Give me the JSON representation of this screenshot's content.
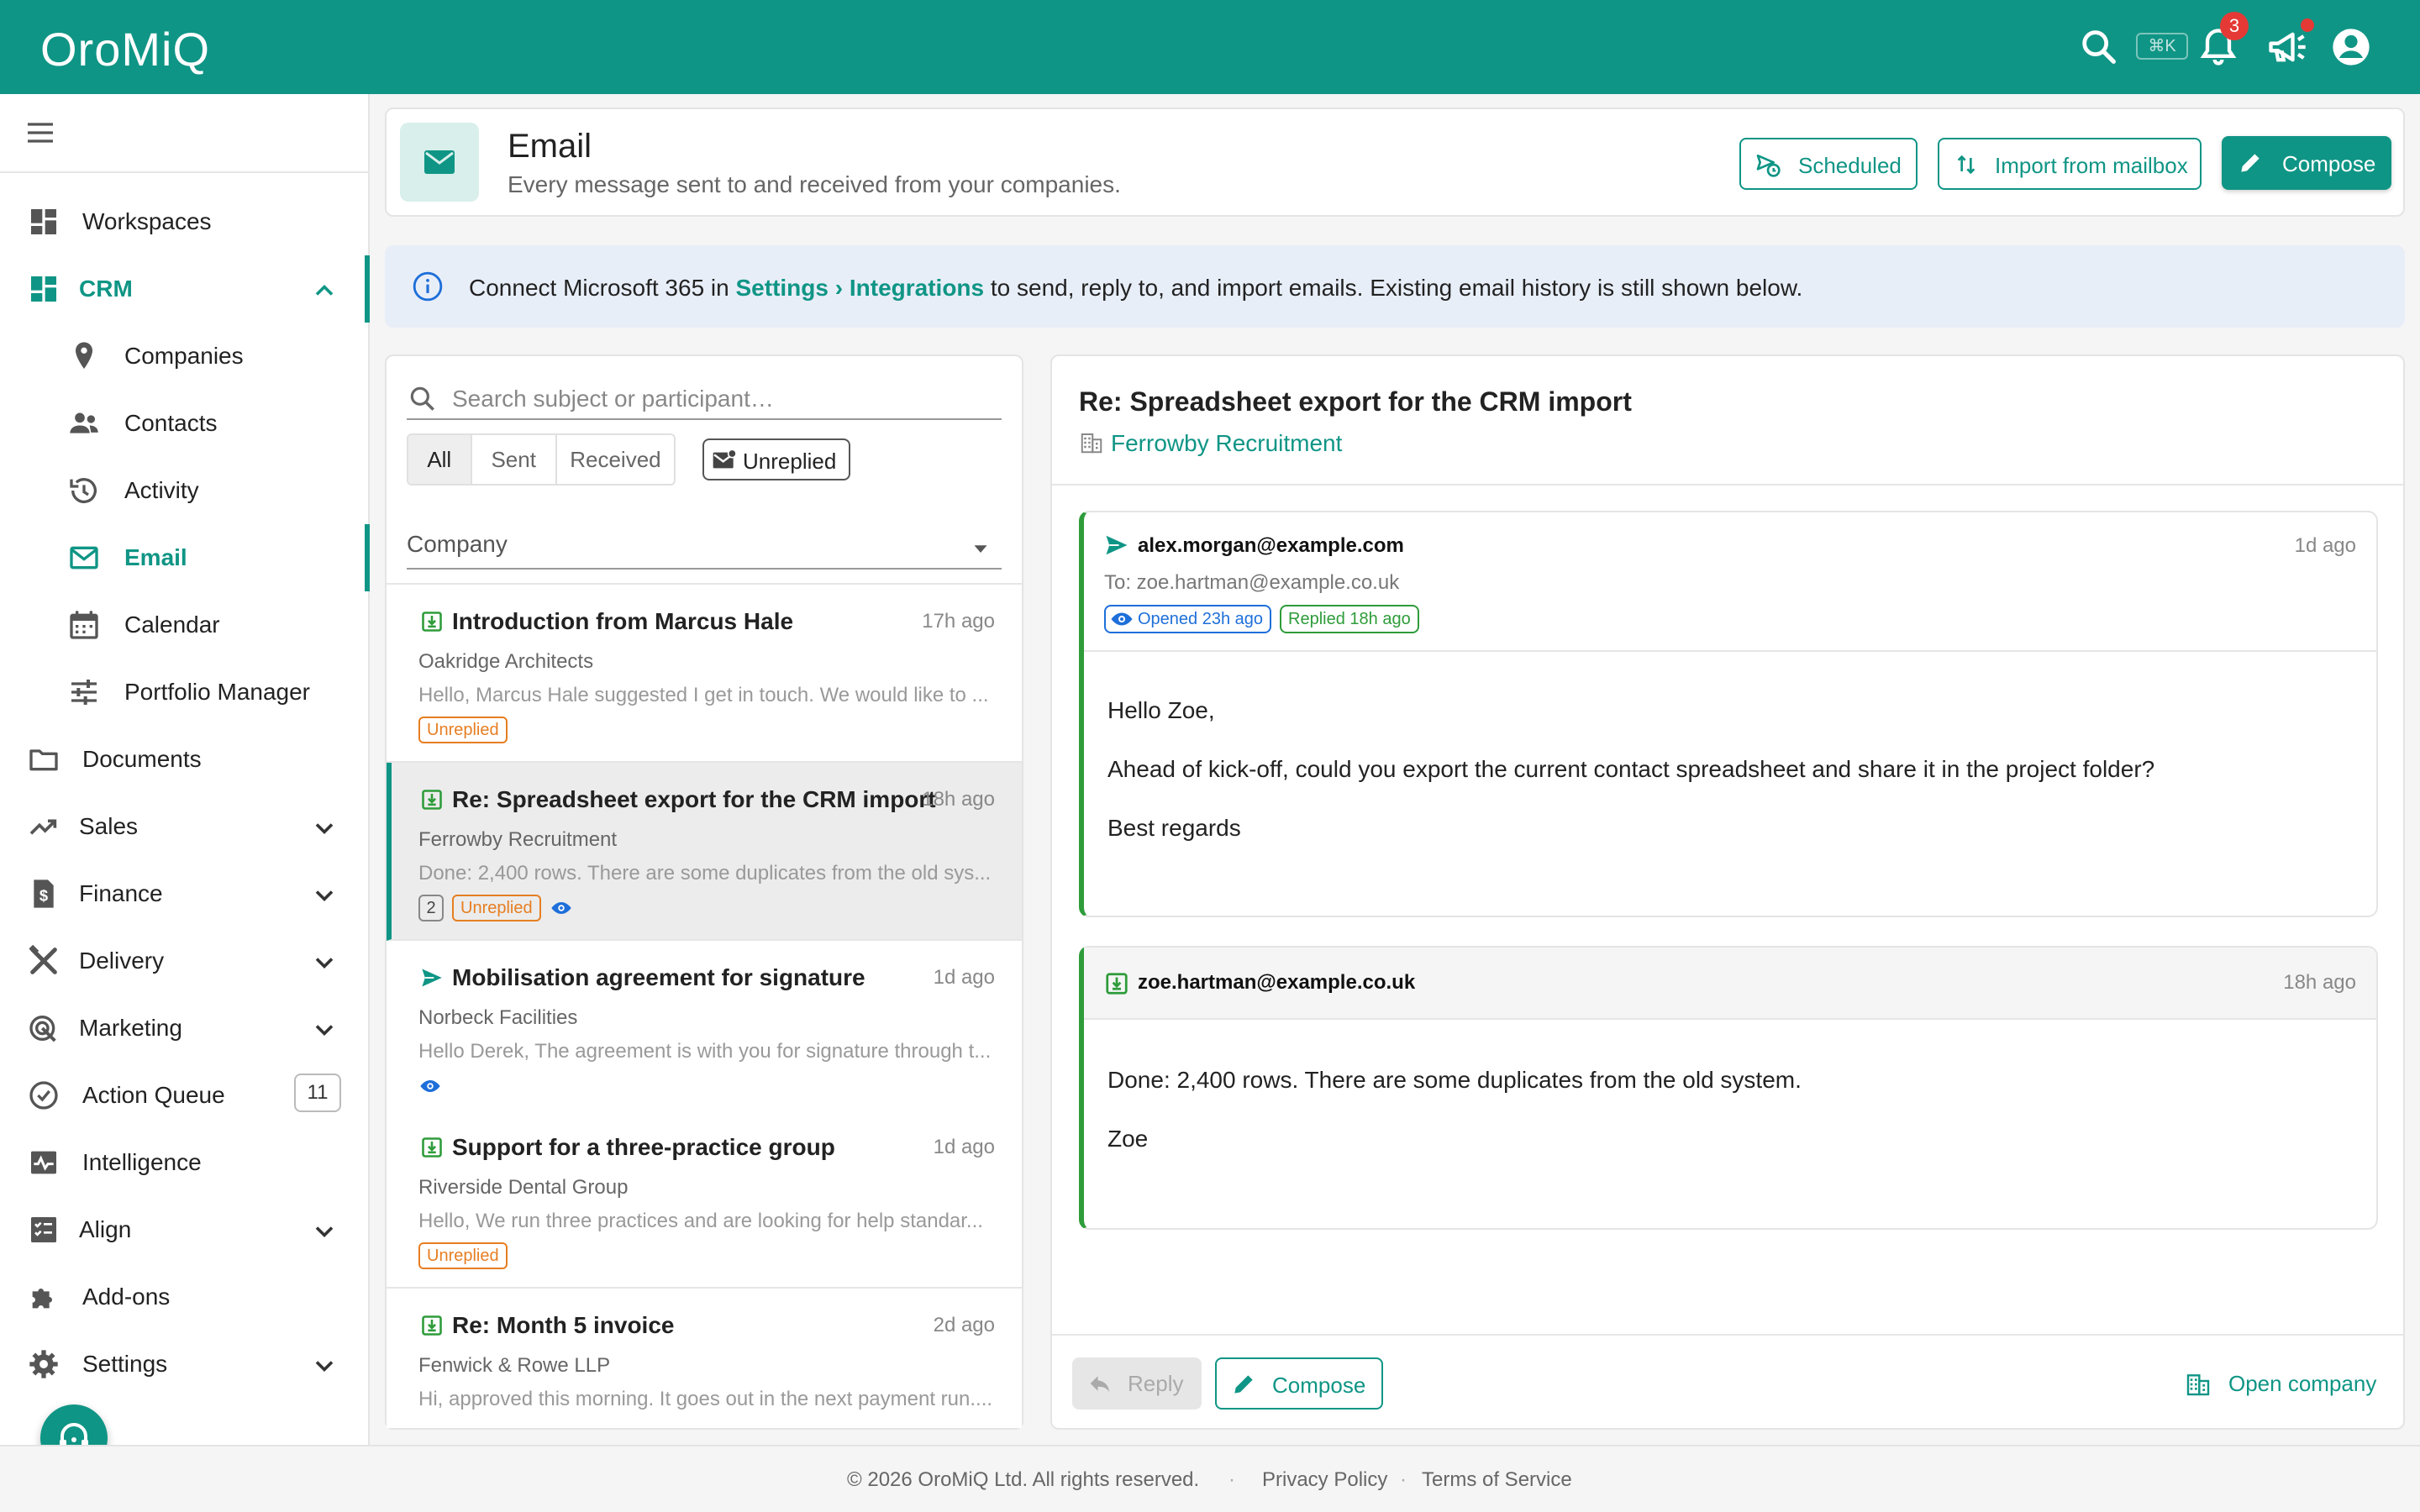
{
  "app": {
    "name": "OroMiQ",
    "shortcut": "⌘K",
    "notification_count": "3"
  },
  "colors": {
    "brand": "#0f9585",
    "accent_green": "#2e9c3a",
    "warning": "#e67e22",
    "link_blue": "#1e6fd9",
    "alert_red": "#e53935"
  },
  "sidebar": {
    "items": [
      {
        "label": "Workspaces",
        "icon": "dashboard-icon"
      },
      {
        "label": "CRM",
        "icon": "crm-grid-icon",
        "expanded": true
      },
      {
        "label": "Companies",
        "icon": "location-pin-icon"
      },
      {
        "label": "Contacts",
        "icon": "people-icon"
      },
      {
        "label": "Activity",
        "icon": "history-icon"
      },
      {
        "label": "Email",
        "icon": "mail-icon",
        "active": true
      },
      {
        "label": "Calendar",
        "icon": "calendar-icon"
      },
      {
        "label": "Portfolio Manager",
        "icon": "tune-icon"
      },
      {
        "label": "Documents",
        "icon": "folder-icon"
      },
      {
        "label": "Sales",
        "icon": "trending-up-icon"
      },
      {
        "label": "Finance",
        "icon": "invoice-icon"
      },
      {
        "label": "Delivery",
        "icon": "tools-icon"
      },
      {
        "label": "Marketing",
        "icon": "target-icon"
      },
      {
        "label": "Action Queue",
        "icon": "check-circle-icon",
        "count": "11"
      },
      {
        "label": "Intelligence",
        "icon": "pulse-icon"
      },
      {
        "label": "Align",
        "icon": "checklist-icon"
      },
      {
        "label": "Add-ons",
        "icon": "puzzle-icon"
      },
      {
        "label": "Settings",
        "icon": "gear-icon"
      }
    ]
  },
  "header": {
    "title": "Email",
    "subtitle": "Every message sent to and received from your companies.",
    "buttons": {
      "scheduled": "Scheduled",
      "import": "Import from mailbox",
      "compose": "Compose"
    }
  },
  "banner": {
    "prefix": "Connect Microsoft 365 in ",
    "link1": "Settings",
    "sep": " › ",
    "link2": "Integrations",
    "suffix": " to send, reply to, and import emails. Existing email history is still shown below."
  },
  "list": {
    "search_placeholder": "Search subject or participant…",
    "filters": [
      "All",
      "Sent",
      "Received"
    ],
    "selected_filter": "All",
    "unreplied_filter": "Unreplied",
    "company_select": "Company",
    "items": [
      {
        "direction": "received",
        "subject": "Introduction from Marcus Hale",
        "time": "17h ago",
        "company": "Oakridge Architects",
        "snippet": "Hello, Marcus Hale suggested I get in touch. We would like to ...",
        "unreplied": "Unreplied"
      },
      {
        "direction": "received",
        "subject": "Re: Spreadsheet export for the CRM import",
        "time": "18h ago",
        "company": "Ferrowby Recruitment",
        "snippet": "Done: 2,400 rows. There are some duplicates from the old sys...",
        "thread_count": "2",
        "unreplied": "Unreplied",
        "opened": true,
        "selected": true
      },
      {
        "direction": "sent",
        "subject": "Mobilisation agreement for signature",
        "time": "1d ago",
        "company": "Norbeck Facilities",
        "snippet": "Hello Derek, The agreement is with you for signature through t...",
        "opened": true
      },
      {
        "direction": "received",
        "subject": "Support for a three-practice group",
        "time": "1d ago",
        "company": "Riverside Dental Group",
        "snippet": "Hello, We run three practices and are looking for help standar...",
        "unreplied": "Unreplied"
      },
      {
        "direction": "received",
        "subject": "Re: Month 5 invoice",
        "time": "2d ago",
        "company": "Fenwick & Rowe LLP",
        "snippet": "Hi, approved this morning. It goes out in the next payment run...."
      }
    ]
  },
  "detail": {
    "subject": "Re: Spreadsheet export for the CRM import",
    "company": "Ferrowby Recruitment",
    "messages": [
      {
        "direction": "sent",
        "from": "alex.morgan@example.com",
        "time": "1d ago",
        "to": "To: zoe.hartman@example.co.uk",
        "opened": "Opened 23h ago",
        "replied": "Replied 18h ago",
        "body": [
          "Hello Zoe,",
          "Ahead of kick-off, could you export the current contact spreadsheet and share it in the project folder?",
          "Best regards"
        ]
      },
      {
        "direction": "received",
        "from": "zoe.hartman@example.co.uk",
        "time": "18h ago",
        "body": [
          "Done: 2,400 rows. There are some duplicates from the old system.",
          "Zoe"
        ]
      }
    ],
    "actions": {
      "reply": "Reply",
      "compose": "Compose",
      "open_company": "Open company"
    }
  },
  "footer": {
    "copyright": "© 2026 OroMiQ Ltd. All rights reserved.",
    "dot": "·",
    "privacy": "Privacy Policy",
    "terms": "Terms of Service"
  }
}
